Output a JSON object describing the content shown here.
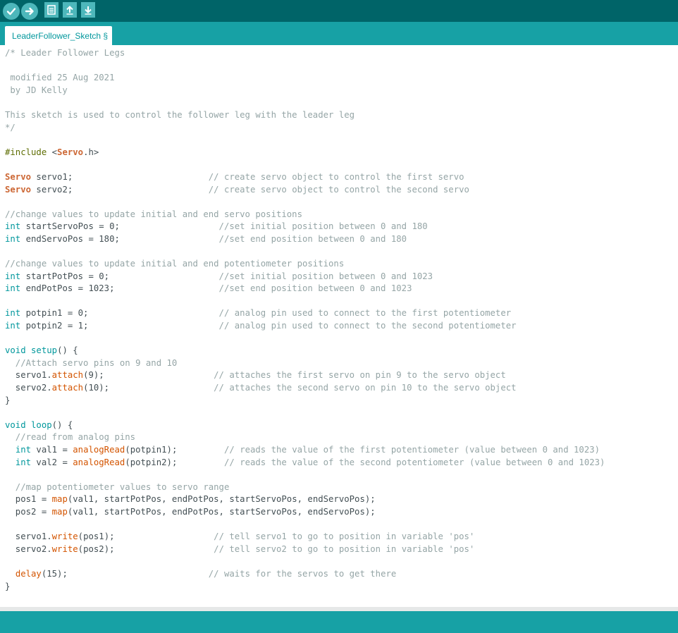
{
  "toolbar": {
    "buttons": [
      {
        "name": "verify-button",
        "icon": "checkmark-icon"
      },
      {
        "name": "upload-button",
        "icon": "arrow-right-icon"
      },
      {
        "name": "new-button",
        "icon": "file-icon"
      },
      {
        "name": "open-button",
        "icon": "arrow-up-icon"
      },
      {
        "name": "save-button",
        "icon": "arrow-down-icon"
      }
    ]
  },
  "tab": {
    "label": "LeaderFollower_Sketch §"
  },
  "colors": {
    "toolbar_bg": "#006468",
    "tabstrip_bg": "#17a1a5",
    "button_bg": "#4db7bb",
    "comment": "#95a5a6",
    "keyword": "#00979c",
    "type": "#cc6633",
    "function": "#d35400",
    "preprocessor": "#5e6d03",
    "text": "#434f54"
  },
  "editor": {
    "lines": [
      [
        [
          "comment",
          "/* Leader Follower Legs"
        ]
      ],
      [],
      [
        [
          "comment",
          " modified 25 Aug 2021"
        ]
      ],
      [
        [
          "comment",
          " by JD Kelly"
        ]
      ],
      [],
      [
        [
          "comment",
          "This sketch is used to control the follower leg with the leader leg"
        ]
      ],
      [
        [
          "comment",
          "*/"
        ]
      ],
      [],
      [
        [
          "pre",
          "#include "
        ],
        [
          "plain",
          "<"
        ],
        [
          "type",
          "Servo"
        ],
        [
          "plain",
          ".h>"
        ]
      ],
      [],
      [
        [
          "type",
          "Servo"
        ],
        [
          "plain",
          " servo1;                          "
        ],
        [
          "comment",
          "// create servo object to control the first servo"
        ]
      ],
      [
        [
          "type",
          "Servo"
        ],
        [
          "plain",
          " servo2;                          "
        ],
        [
          "comment",
          "// create servo object to control the second servo"
        ]
      ],
      [],
      [
        [
          "comment",
          "//change values to update initial and end servo positions"
        ]
      ],
      [
        [
          "kw",
          "int"
        ],
        [
          "plain",
          " startServoPos = 0;                   "
        ],
        [
          "comment",
          "//set initial position between 0 and 180"
        ]
      ],
      [
        [
          "kw",
          "int"
        ],
        [
          "plain",
          " endServoPos = 180;                   "
        ],
        [
          "comment",
          "//set end position between 0 and 180"
        ]
      ],
      [],
      [
        [
          "comment",
          "//change values to update initial and end potentiometer positions"
        ]
      ],
      [
        [
          "kw",
          "int"
        ],
        [
          "plain",
          " startPotPos = 0;                     "
        ],
        [
          "comment",
          "//set initial position between 0 and 1023"
        ]
      ],
      [
        [
          "kw",
          "int"
        ],
        [
          "plain",
          " endPotPos = 1023;                    "
        ],
        [
          "comment",
          "//set end position between 0 and 1023"
        ]
      ],
      [],
      [
        [
          "kw",
          "int"
        ],
        [
          "plain",
          " potpin1 = 0;                         "
        ],
        [
          "comment",
          "// analog pin used to connect to the first potentiometer"
        ]
      ],
      [
        [
          "kw",
          "int"
        ],
        [
          "plain",
          " potpin2 = 1;                         "
        ],
        [
          "comment",
          "// analog pin used to connect to the second potentiometer"
        ]
      ],
      [],
      [
        [
          "kw",
          "void"
        ],
        [
          "plain",
          " "
        ],
        [
          "kw",
          "setup"
        ],
        [
          "plain",
          "() {"
        ]
      ],
      [
        [
          "comment",
          "  //Attach servo pins on 9 and 10"
        ]
      ],
      [
        [
          "plain",
          "  servo1."
        ],
        [
          "fn",
          "attach"
        ],
        [
          "plain",
          "(9);                     "
        ],
        [
          "comment",
          "// attaches the first servo on pin 9 to the servo object"
        ]
      ],
      [
        [
          "plain",
          "  servo2."
        ],
        [
          "fn",
          "attach"
        ],
        [
          "plain",
          "(10);                    "
        ],
        [
          "comment",
          "// attaches the second servo on pin 10 to the servo object"
        ]
      ],
      [
        [
          "plain",
          "}"
        ]
      ],
      [],
      [
        [
          "kw",
          "void"
        ],
        [
          "plain",
          " "
        ],
        [
          "kw",
          "loop"
        ],
        [
          "plain",
          "() {"
        ]
      ],
      [
        [
          "comment",
          "  //read from analog pins"
        ]
      ],
      [
        [
          "plain",
          "  "
        ],
        [
          "kw",
          "int"
        ],
        [
          "plain",
          " val1 = "
        ],
        [
          "fn",
          "analogRead"
        ],
        [
          "plain",
          "(potpin1);         "
        ],
        [
          "comment",
          "// reads the value of the first potentiometer (value between 0 and 1023)"
        ]
      ],
      [
        [
          "plain",
          "  "
        ],
        [
          "kw",
          "int"
        ],
        [
          "plain",
          " val2 = "
        ],
        [
          "fn",
          "analogRead"
        ],
        [
          "plain",
          "(potpin2);         "
        ],
        [
          "comment",
          "// reads the value of the second potentiometer (value between 0 and 1023)"
        ]
      ],
      [],
      [
        [
          "comment",
          "  //map potentiometer values to servo range"
        ]
      ],
      [
        [
          "plain",
          "  pos1 = "
        ],
        [
          "fn",
          "map"
        ],
        [
          "plain",
          "(val1, startPotPos, endPotPos, startServoPos, endServoPos);"
        ]
      ],
      [
        [
          "plain",
          "  pos2 = "
        ],
        [
          "fn",
          "map"
        ],
        [
          "plain",
          "(val1, startPotPos, endPotPos, startServoPos, endServoPos);"
        ]
      ],
      [],
      [
        [
          "plain",
          "  servo1."
        ],
        [
          "fn",
          "write"
        ],
        [
          "plain",
          "(pos1);                   "
        ],
        [
          "comment",
          "// tell servo1 to go to position in variable 'pos'"
        ]
      ],
      [
        [
          "plain",
          "  servo2."
        ],
        [
          "fn",
          "write"
        ],
        [
          "plain",
          "(pos2);                   "
        ],
        [
          "comment",
          "// tell servo2 to go to position in variable 'pos'"
        ]
      ],
      [],
      [
        [
          "plain",
          "  "
        ],
        [
          "fn",
          "delay"
        ],
        [
          "plain",
          "(15);                           "
        ],
        [
          "comment",
          "// waits for the servos to get there"
        ]
      ],
      [
        [
          "plain",
          "}"
        ]
      ]
    ]
  }
}
